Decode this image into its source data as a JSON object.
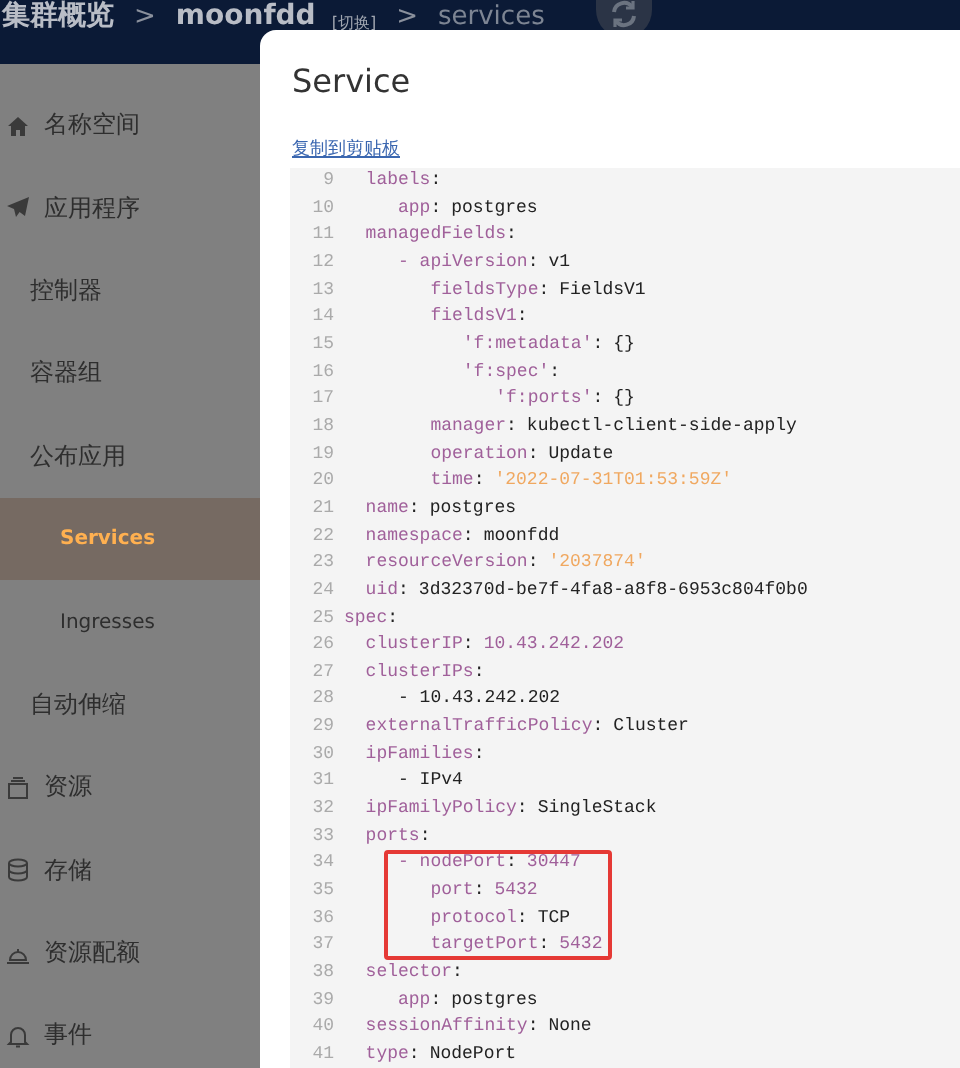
{
  "header": {
    "breadcrumbs": [
      {
        "text": "集群概览",
        "kind": "crumb"
      },
      {
        "text": ">",
        "kind": "sep"
      },
      {
        "text": "moonfdd",
        "kind": "crumb"
      },
      {
        "text": "[切换]",
        "kind": "switch"
      },
      {
        "text": ">",
        "kind": "sep"
      },
      {
        "text": "services",
        "kind": "current"
      }
    ]
  },
  "sidebar": {
    "items": [
      {
        "label": "名称空间",
        "selected": false
      },
      {
        "label": "应用程序",
        "selected": false,
        "children": [
          {
            "label": "控制器",
            "selected": false
          },
          {
            "label": "容器组",
            "selected": false
          },
          {
            "label": "公布应用",
            "selected": false,
            "children": [
              {
                "label": "Services",
                "selected": true
              },
              {
                "label": "Ingresses",
                "selected": false
              }
            ]
          },
          {
            "label": "自动伸缩",
            "selected": false
          }
        ]
      },
      {
        "label": "资源",
        "selected": false
      },
      {
        "label": "存储",
        "selected": false
      },
      {
        "label": "资源配额",
        "selected": false
      },
      {
        "label": "事件",
        "selected": false
      }
    ]
  },
  "dialog": {
    "title": "Service",
    "copy_link": "复制到剪贴板",
    "code_lines": [
      {
        "number": "9",
        "key": "  labels",
        "colon": ":",
        "highlighted": false
      },
      {
        "number": "10",
        "key": "     app",
        "colon": ":",
        "value": "postgres",
        "kind": "plain",
        "highlighted": false
      },
      {
        "number": "11",
        "key": "  managedFields",
        "colon": ":",
        "highlighted": false
      },
      {
        "number": "12",
        "key": "     - apiVersion",
        "colon": ":",
        "value": "v1",
        "kind": "plain",
        "highlighted": false
      },
      {
        "number": "13",
        "key": "        fieldsType",
        "colon": ":",
        "value": "FieldsV1",
        "kind": "plain",
        "highlighted": false
      },
      {
        "number": "14",
        "key": "        fieldsV1",
        "colon": ":",
        "highlighted": false
      },
      {
        "number": "15",
        "key": "           'f:metadata'",
        "colon": ":",
        "value": "{}",
        "kind": "plain",
        "highlighted": false
      },
      {
        "number": "16",
        "key": "           'f:spec'",
        "colon": ":",
        "highlighted": false
      },
      {
        "number": "17",
        "key": "              'f:ports'",
        "colon": ":",
        "value": "{}",
        "kind": "plain",
        "highlighted": false
      },
      {
        "number": "18",
        "key": "        manager",
        "colon": ":",
        "value": "kubectl-client-side-apply",
        "kind": "plain",
        "highlighted": false
      },
      {
        "number": "19",
        "key": "        operation",
        "colon": ":",
        "value": "Update",
        "kind": "plain",
        "highlighted": false
      },
      {
        "number": "20",
        "key": "        time",
        "colon": ":",
        "value": "'2022-07-31T01:53:59Z'",
        "kind": "string",
        "highlighted": false
      },
      {
        "number": "21",
        "key": "  name",
        "colon": ":",
        "value": "postgres",
        "kind": "plain",
        "highlighted": false
      },
      {
        "number": "22",
        "key": "  namespace",
        "colon": ":",
        "value": "moonfdd",
        "kind": "plain",
        "highlighted": false
      },
      {
        "number": "23",
        "key": "  resourceVersion",
        "colon": ":",
        "value": "'2037874'",
        "kind": "string",
        "highlighted": false
      },
      {
        "number": "24",
        "key": "  uid",
        "colon": ":",
        "value": "3d32370d-be7f-4fa8-a8f8-6953c804f0b0",
        "kind": "plain",
        "highlighted": false
      },
      {
        "number": "25",
        "key": "spec",
        "colon": ":",
        "highlighted": false
      },
      {
        "number": "26",
        "key": "  clusterIP",
        "colon": ":",
        "value": "10.43.242.202",
        "kind": "number",
        "highlighted": false
      },
      {
        "number": "27",
        "key": "  clusterIPs",
        "colon": ":",
        "highlighted": false
      },
      {
        "number": "28",
        "value": "     - 10.43.242.202",
        "kind": "plain",
        "highlighted": false
      },
      {
        "number": "29",
        "key": "  externalTrafficPolicy",
        "colon": ":",
        "value": "Cluster",
        "kind": "plain",
        "highlighted": false
      },
      {
        "number": "30",
        "key": "  ipFamilies",
        "colon": ":",
        "highlighted": false
      },
      {
        "number": "31",
        "value": "     - IPv4",
        "kind": "plain",
        "highlighted": false
      },
      {
        "number": "32",
        "key": "  ipFamilyPolicy",
        "colon": ":",
        "value": "SingleStack",
        "kind": "plain",
        "highlighted": false
      },
      {
        "number": "33",
        "key": "  ports",
        "colon": ":",
        "highlighted": false
      },
      {
        "number": "34",
        "key": "     - nodePort",
        "colon": ":",
        "value": "30447",
        "kind": "number",
        "highlighted": true
      },
      {
        "number": "35",
        "key": "        port",
        "colon": ":",
        "value": "5432",
        "kind": "number",
        "highlighted": true
      },
      {
        "number": "36",
        "key": "        protocol",
        "colon": ":",
        "value": "TCP",
        "kind": "plain",
        "highlighted": true
      },
      {
        "number": "37",
        "key": "        targetPort",
        "colon": ":",
        "value": "5432",
        "kind": "number",
        "highlighted": true
      },
      {
        "number": "38",
        "key": "  selector",
        "colon": ":",
        "highlighted": false
      },
      {
        "number": "39",
        "key": "     app",
        "colon": ":",
        "value": "postgres",
        "kind": "plain",
        "highlighted": false
      },
      {
        "number": "40",
        "key": "  sessionAffinity",
        "colon": ":",
        "value": "None",
        "kind": "plain",
        "highlighted": false
      },
      {
        "number": "41",
        "key": "  type",
        "colon": ":",
        "value": "NodePort",
        "kind": "plain",
        "highlighted": false
      }
    ]
  }
}
